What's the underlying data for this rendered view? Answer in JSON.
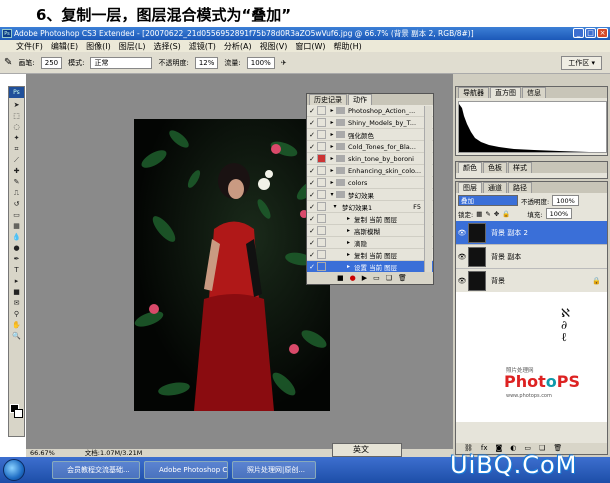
{
  "caption": "6、复制一层，图层混合模式为“叠加”",
  "window": {
    "title": "Adobe Photoshop CS3 Extended - [20070622_21d0556952891f75b78d0R3aZO5wVuf6.jpg @ 66.7% (背景 副本 2, RGB/8#)]"
  },
  "menu": [
    "文件(F)",
    "编辑(E)",
    "图像(I)",
    "图层(L)",
    "选择(S)",
    "滤镜(T)",
    "分析(A)",
    "视图(V)",
    "窗口(W)",
    "帮助(H)"
  ],
  "options": {
    "brush_label": "画笔:",
    "brush_size": "250",
    "mode_label": "模式:",
    "mode_value": "正常",
    "opacity_label": "不透明度:",
    "opacity_value": "12%",
    "flow_label": "流量:",
    "flow_value": "100%",
    "workspace": "工作区 ▾"
  },
  "actions_panel": {
    "tabs": [
      "历史记录",
      "动作"
    ],
    "rows": [
      {
        "label": "Photoshop_Action_...",
        "type": "folder"
      },
      {
        "label": "Shiny_Models_by_T...",
        "type": "folder"
      },
      {
        "label": "强化颜色",
        "type": "folder"
      },
      {
        "label": "Cold_Tones_for_Bla...",
        "type": "folder"
      },
      {
        "label": "skin_tone_by_boroni",
        "type": "folder"
      },
      {
        "label": "Enhancing_skin_colo...",
        "type": "folder"
      },
      {
        "label": "colors",
        "type": "folder"
      },
      {
        "label": "梦幻效果",
        "type": "folder"
      },
      {
        "label": "梦幻效果1",
        "type": "action",
        "shortcut": "F5"
      },
      {
        "label": "复制 当前 图层",
        "type": "step"
      },
      {
        "label": "高斯模糊",
        "type": "step"
      },
      {
        "label": "滴隐",
        "type": "step"
      },
      {
        "label": "复制 当前 图层",
        "type": "step"
      },
      {
        "label": "设置 当前 图层",
        "type": "step",
        "selected": true
      }
    ]
  },
  "navigator_panel": {
    "tabs": [
      "导航器",
      "直方图",
      "信息"
    ]
  },
  "color_panel": {
    "tabs": [
      "颜色",
      "色板",
      "样式"
    ]
  },
  "layers_panel": {
    "tabs": [
      "图层",
      "通道",
      "路径"
    ],
    "blend_mode": "叠加",
    "opacity_label": "不透明度:",
    "opacity_value": "100%",
    "lock_label": "锁定:",
    "fill_label": "填充:",
    "fill_value": "100%",
    "layers": [
      {
        "name": "背景 副本 2",
        "selected": true
      },
      {
        "name": "背景 副本",
        "selected": false
      },
      {
        "name": "背景",
        "selected": false
      }
    ]
  },
  "logo": {
    "sub": "照片处理网",
    "brand_a": "Phot",
    "brand_o": "o",
    "brand_b": "PS",
    "url": "www.photops.com"
  },
  "status": {
    "zoom": "66.67%",
    "doc": "文档:1.07M/3.21M"
  },
  "ime": "英文",
  "taskbar": {
    "tasks": [
      "会员教程交流基础...",
      "Adobe Photoshop CS...",
      "照片处理网|原创..."
    ]
  },
  "watermark": "UiBQ.CoM",
  "colors": {
    "title_blue": "#1c58b8",
    "selection_blue": "#3a6fd8",
    "canvas_gray": "#8a8a8a"
  }
}
